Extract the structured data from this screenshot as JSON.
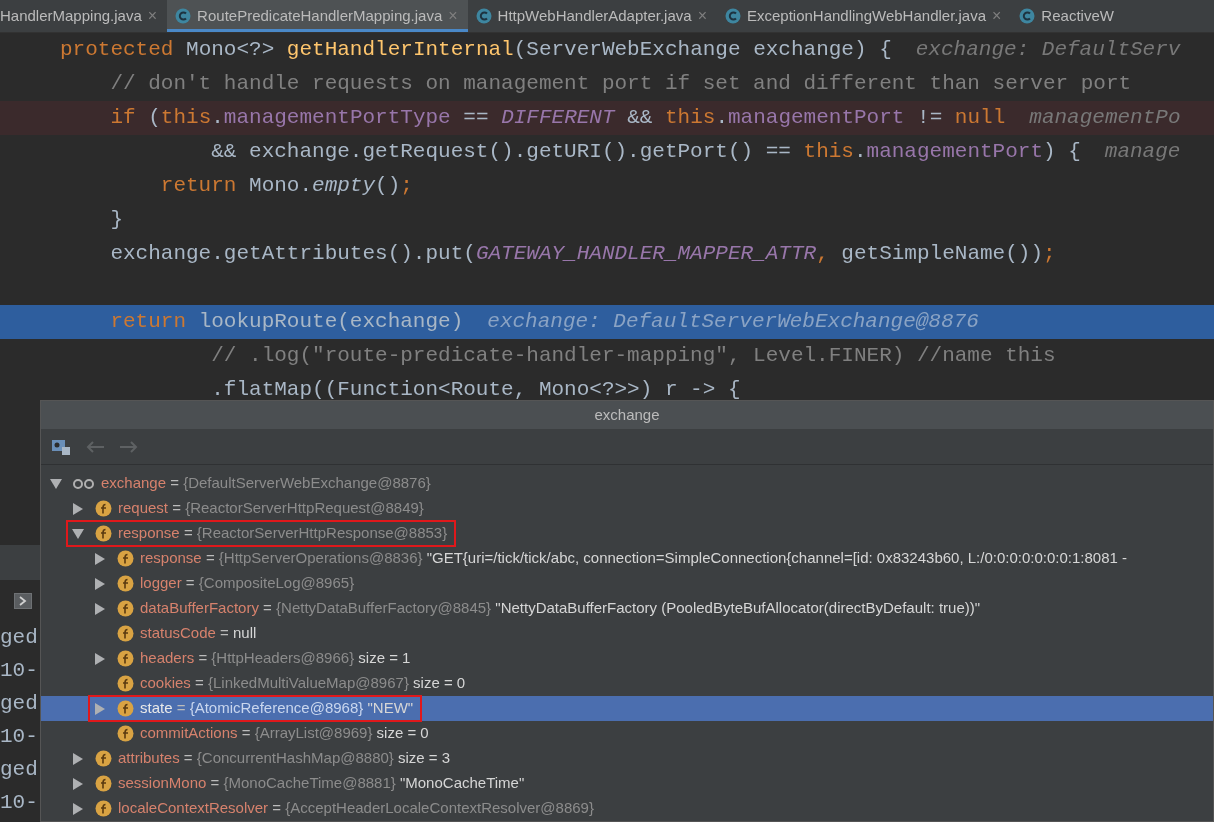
{
  "tabs": [
    {
      "label": "HandlerMapping.java",
      "selected": false,
      "close": "×"
    },
    {
      "label": "RoutePredicateHandlerMapping.java",
      "selected": true,
      "close": "×",
      "kind": "class"
    },
    {
      "label": "HttpWebHandlerAdapter.java",
      "selected": false,
      "close": "×",
      "kind": "class"
    },
    {
      "label": "ExceptionHandlingWebHandler.java",
      "selected": false,
      "close": "×",
      "kind": "class"
    },
    {
      "label": "ReactiveW",
      "selected": false,
      "kind": "class"
    }
  ],
  "code_lines": [
    {
      "kind": "code",
      "breakpoint": false,
      "current": false,
      "tokens": [
        {
          "t": "protected ",
          "kind": "kw"
        },
        {
          "t": "Mono<?> ",
          "kind": "plain"
        },
        {
          "t": "getHandlerInternal",
          "kind": "method"
        },
        {
          "t": "(ServerWebExchange exchange) {",
          "kind": "plain"
        }
      ],
      "hint": "exchange: DefaultServ"
    },
    {
      "kind": "code",
      "breakpoint": false,
      "current": false,
      "tokens": [
        {
          "t": "    // don't handle requests on management port if set and different than server port",
          "kind": "comment"
        }
      ]
    },
    {
      "kind": "code",
      "breakpoint": true,
      "current": false,
      "tokens": [
        {
          "t": "    if ",
          "kind": "kw"
        },
        {
          "t": "(",
          "kind": "plain"
        },
        {
          "t": "this",
          "kind": "kw"
        },
        {
          "t": ".",
          "kind": "plain"
        },
        {
          "t": "managementPortType",
          "kind": "field"
        },
        {
          "t": " == ",
          "kind": "plain"
        },
        {
          "t": "DIFFERENT",
          "kind": "const"
        },
        {
          "t": " && ",
          "kind": "plain"
        },
        {
          "t": "this",
          "kind": "kw"
        },
        {
          "t": ".",
          "kind": "plain"
        },
        {
          "t": "managementPort",
          "kind": "field"
        },
        {
          "t": " != ",
          "kind": "plain"
        },
        {
          "t": "null",
          "kind": "kw"
        }
      ],
      "hint": "managementPo"
    },
    {
      "kind": "code",
      "breakpoint": false,
      "current": false,
      "tokens": [
        {
          "t": "            && exchange.getRequest().getURI().getPort() == ",
          "kind": "plain"
        },
        {
          "t": "this",
          "kind": "kw"
        },
        {
          "t": ".",
          "kind": "plain"
        },
        {
          "t": "managementPort",
          "kind": "field"
        },
        {
          "t": ") {",
          "kind": "plain"
        }
      ],
      "hint": "manage"
    },
    {
      "kind": "code",
      "breakpoint": false,
      "current": false,
      "tokens": [
        {
          "t": "        return ",
          "kind": "kw"
        },
        {
          "t": "Mono.",
          "kind": "plain"
        },
        {
          "t": "empty",
          "kind": "italic"
        },
        {
          "t": "()",
          "kind": "plain"
        },
        {
          "t": ";",
          "kind": "kw"
        }
      ]
    },
    {
      "kind": "code",
      "breakpoint": false,
      "current": false,
      "tokens": [
        {
          "t": "    }",
          "kind": "plain"
        }
      ]
    },
    {
      "kind": "code",
      "breakpoint": false,
      "current": false,
      "tokens": [
        {
          "t": "    exchange.getAttributes().put(",
          "kind": "plain"
        },
        {
          "t": "GATEWAY_HANDLER_MAPPER_ATTR",
          "kind": "const"
        },
        {
          "t": ", ",
          "kind": "kw"
        },
        {
          "t": "getSimpleName())",
          "kind": "plain"
        },
        {
          "t": ";",
          "kind": "kw"
        }
      ]
    },
    {
      "kind": "blank"
    },
    {
      "kind": "code",
      "breakpoint": false,
      "current": true,
      "tokens": [
        {
          "t": "    return ",
          "kind": "kw"
        },
        {
          "t": "lookupRoute(exchange)",
          "kind": "plain"
        }
      ],
      "hint": "exchange: DefaultServerWebExchange@8876"
    },
    {
      "kind": "code",
      "breakpoint": false,
      "current": false,
      "tokens": [
        {
          "t": "            // .log(\"route-predicate-handler-mapping\", Level.FINER) //name this",
          "kind": "comment"
        }
      ]
    },
    {
      "kind": "code",
      "breakpoint": false,
      "current": false,
      "tokens": [
        {
          "t": "            .flatMap((Function<Route, Mono<?>>) r -> {",
          "kind": "plain"
        }
      ]
    }
  ],
  "console_lines": [
    "ged",
    "10-",
    "ged",
    "10-",
    "ged",
    "10-"
  ],
  "popup": {
    "title": "exchange",
    "tree": [
      {
        "name": "exchange",
        "eq": "=",
        "value": "{DefaultServerWebExchange@8876}",
        "expanded": true,
        "selected": false,
        "boxed": false,
        "children": [
          {
            "name": "request",
            "eq": "=",
            "value": "{ReactorServerHttpRequest@8849}",
            "expanded": false,
            "selected": false,
            "boxed": false
          },
          {
            "name": "response",
            "eq": "=",
            "value": "{ReactorServerHttpResponse@8853}",
            "expanded": true,
            "selected": false,
            "boxed": true,
            "children": [
              {
                "name": "response",
                "eq": "=",
                "value": "{HttpServerOperations@8836}",
                "extra": "\"GET{uri=/tick/tick/abc, connection=SimpleConnection{channel=[id: 0x83243b60, L:/0:0:0:0:0:0:0:1:8081 -",
                "expanded": false,
                "selected": false,
                "boxed": false
              },
              {
                "name": "logger",
                "eq": "=",
                "value": "{CompositeLog@8965}",
                "expanded": false,
                "selected": false,
                "boxed": false
              },
              {
                "name": "dataBufferFactory",
                "eq": "=",
                "value": "{NettyDataBufferFactory@8845}",
                "extra": "\"NettyDataBufferFactory (PooledByteBufAllocator(directByDefault: true))\"",
                "expanded": false,
                "selected": false,
                "boxed": false
              },
              {
                "kind": "null",
                "name": "statusCode",
                "eq": "=",
                "value": "null",
                "selected": false,
                "boxed": false
              },
              {
                "name": "headers",
                "eq": "=",
                "value": "{HttpHeaders@8966}",
                "extra": "size = 1",
                "expanded": false,
                "selected": false,
                "boxed": false
              },
              {
                "kind": "leaf",
                "name": "cookies",
                "eq": "=",
                "value": "{LinkedMultiValueMap@8967}",
                "extra": "size = 0",
                "selected": false,
                "boxed": false
              },
              {
                "name": "state",
                "eq": "=",
                "value": "{AtomicReference@8968}",
                "extra": "\"NEW\"",
                "expanded": false,
                "selected": true,
                "boxed": true
              },
              {
                "kind": "leaf",
                "name": "commitActions",
                "eq": "=",
                "value": "{ArrayList@8969}",
                "extra": "size = 0",
                "selected": false,
                "boxed": false
              }
            ]
          },
          {
            "name": "attributes",
            "eq": "=",
            "value": "{ConcurrentHashMap@8880}",
            "extra": "size = 3",
            "expanded": false,
            "selected": false,
            "boxed": false
          },
          {
            "name": "sessionMono",
            "eq": "=",
            "value": "{MonoCacheTime@8881}",
            "extra": "\"MonoCacheTime\"",
            "expanded": false,
            "selected": false,
            "boxed": false
          },
          {
            "name": "localeContextResolver",
            "eq": "=",
            "value": "{AcceptHeaderLocaleContextResolver@8869}",
            "expanded": false,
            "selected": false,
            "boxed": false
          }
        ]
      }
    ]
  }
}
